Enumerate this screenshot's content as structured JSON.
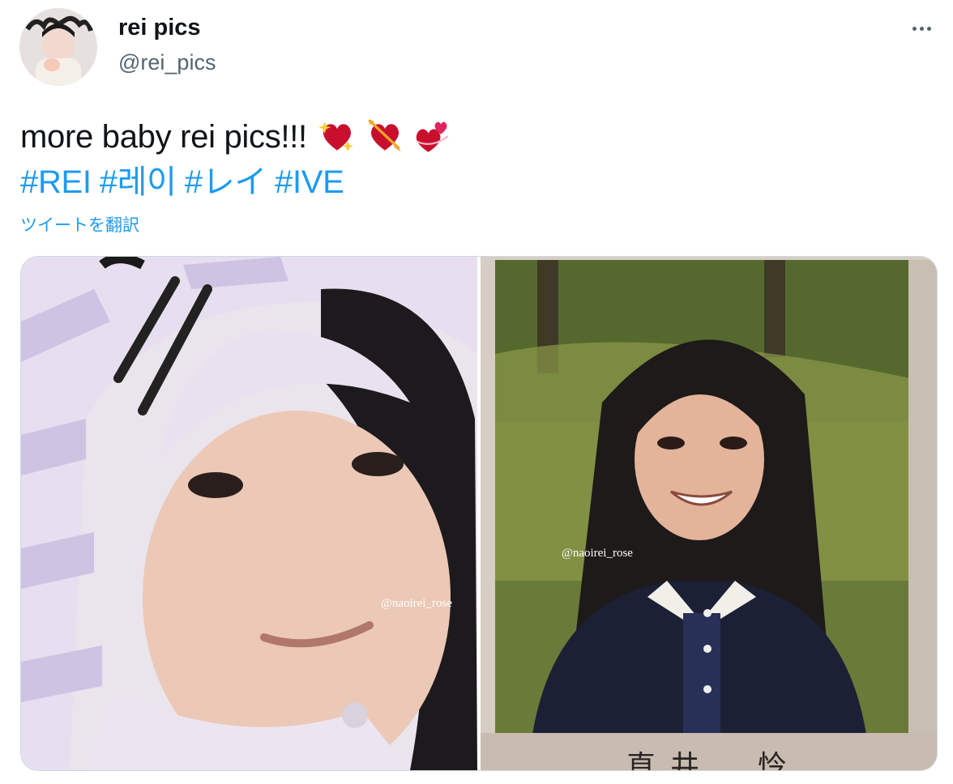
{
  "user": {
    "display_name": "rei pics",
    "handle": "@rei_pics",
    "avatar_icon": "profile-photo"
  },
  "tweet": {
    "text": "more baby rei pics!!!",
    "emojis": [
      "sparkling-heart-icon",
      "heart-with-arrow-icon",
      "two-hearts-icon"
    ],
    "hashtags": [
      "#REI",
      "#레이",
      "#レイ",
      "#IVE"
    ],
    "translate_label": "ツイートを翻訳"
  },
  "media": {
    "left_watermark": "@naoirei_rose",
    "right_watermark": "@naoirei_rose",
    "right_caption": "直井　怜"
  },
  "colors": {
    "link": "#1d9bf0",
    "text": "#0f1419",
    "muted": "#536471"
  }
}
